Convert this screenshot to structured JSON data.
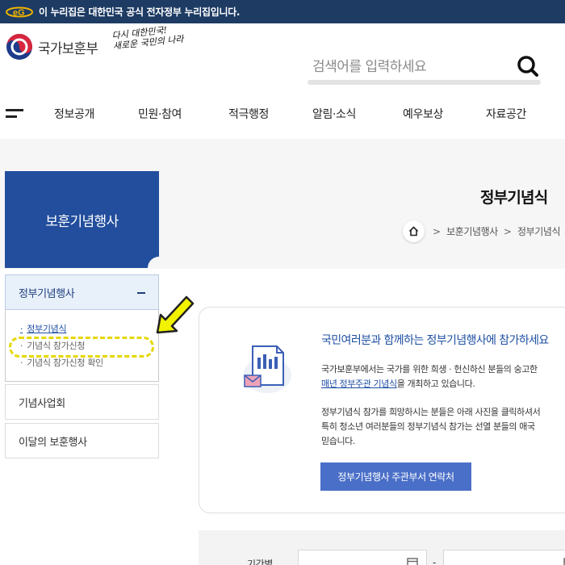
{
  "gov_banner": {
    "text": "이 누리집은 대한민국 공식 전자정부 누리집입니다.",
    "logo_icon": "egovernment-logo-icon"
  },
  "header": {
    "brand_name": "국가보훈부",
    "slogan_line1": "다시 대한민국!",
    "slogan_line2": "새로운 국민의 나라",
    "search_placeholder": "검색어를 입력하세요",
    "search_icon": "search-icon"
  },
  "gnb": {
    "menu_icon": "hamburger-menu-icon",
    "items": [
      "정보공개",
      "민원·참여",
      "적극행정",
      "알림·소식",
      "예우보상",
      "자료공간"
    ]
  },
  "page": {
    "title": "정부기념식",
    "breadcrumb": [
      "보훈기념행사",
      "정부기념식"
    ]
  },
  "sidebar": {
    "title": "보훈기념행사",
    "active_item": "정부기념행사",
    "sub_items": [
      "정부기념식",
      "기념식 참가신청",
      "기념식 참가신청 확인"
    ],
    "items": [
      "기념사업회",
      "이달의 보훈행사"
    ]
  },
  "info": {
    "heading": "국민여러분과 함께하는 정부기념행사에 참가하세요",
    "p1_line1": "국가보훈부에서는 국가를 위한 희생 · 헌신하신 분들의 숭고한",
    "p1_line2_link": "매년 정부주관 기념식",
    "p1_line2_rest": "을 개최하고 있습니다.",
    "p2_line1": "정부기념식 참가를 희망하시는 분들은 아래 사진을 클릭하셔서",
    "p2_line2": "특히 청소년 여러분들의 정부기념식 참가는 선열 분들의 애국",
    "p2_line3": "믿습니다.",
    "contact_button": "정부기념행사 주관부서 연락처"
  },
  "filter": {
    "period_label": "기간별",
    "dash": "-"
  },
  "colors": {
    "gov_bar": "#1d3b63",
    "sidebar_title_bg": "#234e9d",
    "accent_blue": "#1e4fa3",
    "button_blue": "#4a6fc8",
    "highlight_yellow": "#e6d800"
  }
}
